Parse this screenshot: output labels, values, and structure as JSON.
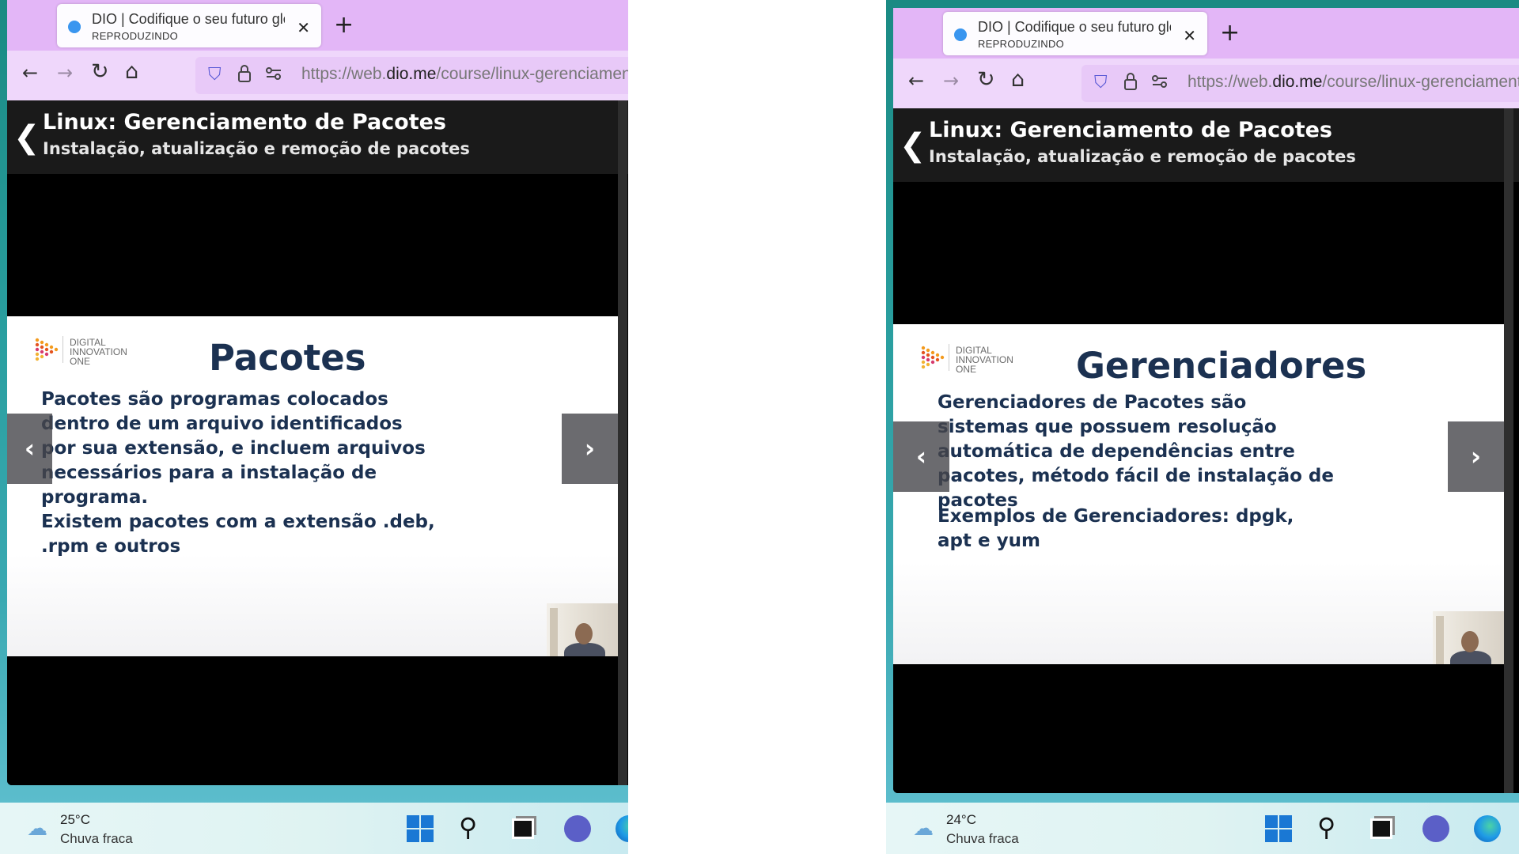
{
  "left": {
    "tab": {
      "title": "DIO | Codifique o seu futuro global",
      "status": "REPRODUZINDO",
      "close": "✕"
    },
    "url": {
      "prefix": "https://web.",
      "domain": "dio.me",
      "path": "/course/linux-gerenciamento-de-pacotes"
    },
    "course": {
      "title": "Linux: Gerenciamento de Pacotes",
      "subtitle": "Instalação, atualização e remoção de pacotes"
    },
    "slide": {
      "logo_lines": [
        "DIGITAL",
        "INNOVATION",
        "ONE"
      ],
      "title": "Pacotes",
      "body": "Pacotes são programas colocados dentro de um arquivo identificados por sua extensão, e incluem arquivos necessários para a instalação de programa.",
      "body2": "Existem pacotes com a extensão .deb, .rpm e outros"
    },
    "weather": {
      "temp": "25°C",
      "condition": "Chuva fraca"
    }
  },
  "right": {
    "tab": {
      "title": "DIO | Codifique o seu futuro global",
      "status": "REPRODUZINDO",
      "close": "✕"
    },
    "url": {
      "prefix": "https://web.",
      "domain": "dio.me",
      "path": "/course/linux-gerenciamento-de-pacotes"
    },
    "course": {
      "title": "Linux: Gerenciamento de Pacotes",
      "subtitle": "Instalação, atualização e remoção de pacotes"
    },
    "slide": {
      "logo_lines": [
        "DIGITAL",
        "INNOVATION",
        "ONE"
      ],
      "title": "Gerenciadores",
      "body": "Gerenciadores de Pacotes são sistemas que possuem resolução automática de dependências entre pacotes, método fácil de instalação de pacotes",
      "body2": "Exemplos de Gerenciadores: dpgk, apt e yum"
    },
    "weather": {
      "temp": "24°C",
      "condition": "Chuva fraca"
    }
  },
  "glyphs": {
    "new_tab": "+",
    "back": "←",
    "forward": "→",
    "reload": "↻",
    "home": "⌂",
    "shield": "⛉",
    "lock": "🔒",
    "permissions": "⚲",
    "course_back": "❮",
    "slide_prev": "‹",
    "slide_next": "›",
    "weather": "☁",
    "search": "⚲"
  }
}
